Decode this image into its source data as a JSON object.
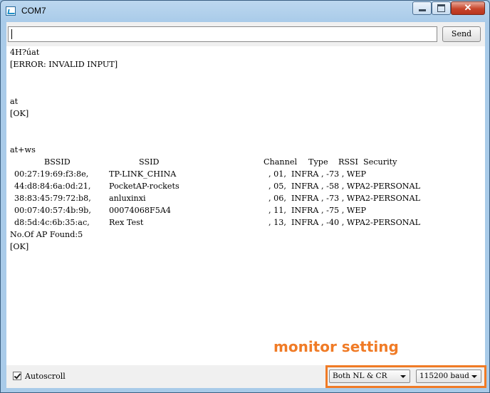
{
  "window": {
    "title": "COM7",
    "controls": {
      "close": "✕"
    }
  },
  "input": {
    "value": ""
  },
  "send_button": {
    "label": "Send"
  },
  "output": {
    "lines": [
      "4H?úat",
      "[ERROR: INVALID INPUT]",
      "at",
      "[OK]",
      "at+ws"
    ],
    "table": {
      "headers": [
        "BSSID",
        "SSID",
        "Channel",
        "Type",
        "RSSI",
        "Security"
      ],
      "rows": [
        {
          "bssid": "00:27:19:69:f3:8e,",
          "ssid": "TP-LINK_CHINA",
          "rest": ", 01,  INFRA , -73 , WEP"
        },
        {
          "bssid": "44:d8:84:6a:0d:21,",
          "ssid": "PocketAP-rockets",
          "rest": ", 05,  INFRA , -58 , WPA2-PERSONAL"
        },
        {
          "bssid": "38:83:45:79:72:b8,",
          "ssid": "anluxinxi",
          "rest": ", 06,  INFRA , -73 , WPA2-PERSONAL"
        },
        {
          "bssid": "00:07:40:57:4b:9b,",
          "ssid": "00074068F5A4",
          "rest": ", 11,  INFRA , -75 , WEP"
        },
        {
          "bssid": "d8:5d:4c:6b:35:ac,",
          "ssid": "Rex Test",
          "rest": ", 13,  INFRA , -40 , WPA2-PERSONAL"
        }
      ]
    },
    "footer_lines": [
      "No.Of AP Found:5",
      "[OK]"
    ]
  },
  "status": {
    "autoscroll_label": "Autoscroll",
    "autoscroll_checked": true,
    "line_ending": "Both NL & CR",
    "baud": "115200 baud"
  },
  "annotation": {
    "text": "monitor setting",
    "color": "#f07b26"
  }
}
